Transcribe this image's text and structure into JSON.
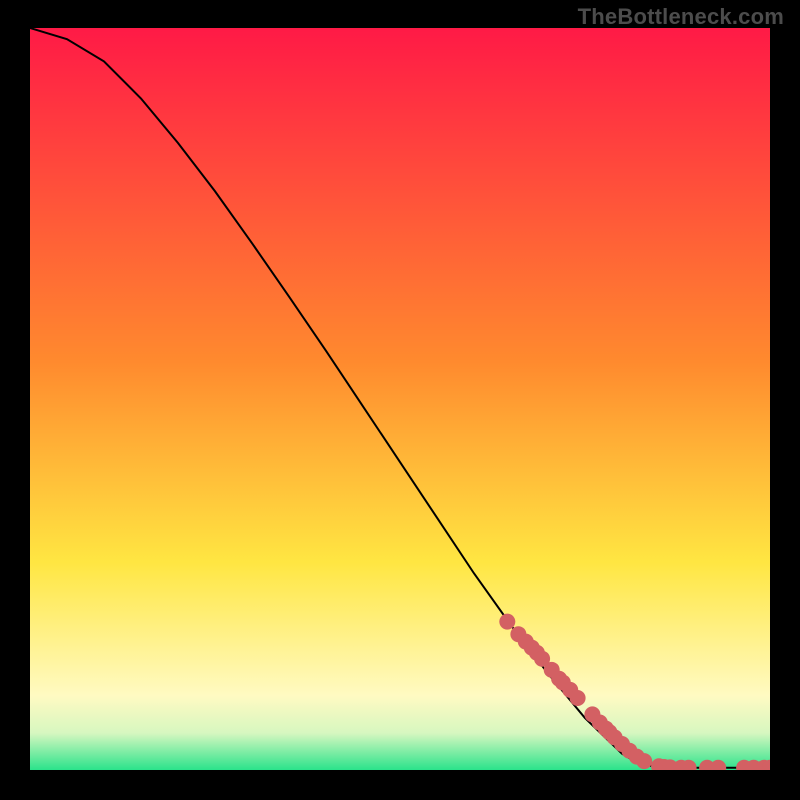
{
  "watermark": "TheBottleneck.com",
  "colors": {
    "bg": "#000000",
    "curve": "#000000",
    "marker": "#d36063",
    "watermark": "#4c4c4c",
    "grad_top": "#ff1a46",
    "grad_mid1": "#ff8a2e",
    "grad_mid2": "#ffe642",
    "grad_mid3": "#fffac2",
    "grad_band": "#d7f7c0",
    "grad_bot": "#2be38b"
  },
  "chart_data": {
    "type": "line",
    "title": "",
    "xlabel": "",
    "ylabel": "",
    "xlim": [
      0,
      100
    ],
    "ylim": [
      0,
      100
    ],
    "series": [
      {
        "name": "curve",
        "x": [
          0,
          5,
          10,
          15,
          20,
          25,
          30,
          35,
          40,
          45,
          50,
          55,
          60,
          65,
          70,
          75,
          80,
          82,
          85,
          90,
          95,
          100
        ],
        "y": [
          100,
          98.5,
          95.5,
          90.5,
          84.5,
          78,
          71,
          63.8,
          56.5,
          49,
          41.5,
          34,
          26.5,
          19.5,
          13,
          7,
          2.2,
          1.0,
          0.3,
          0.3,
          0.3,
          0.3
        ]
      },
      {
        "name": "markers",
        "x": [
          64.5,
          66.0,
          67.0,
          67.8,
          68.5,
          69.2,
          70.5,
          71.5,
          72.0,
          73.0,
          74.0,
          76.0,
          77.0,
          77.8,
          78.3,
          79.0,
          80.0,
          81.0,
          82.0,
          83.0,
          85.0,
          85.7,
          86.5,
          88.0,
          89.0,
          91.5,
          93.0,
          96.5,
          97.8,
          99.2,
          100.0
        ],
        "y": [
          20.0,
          18.3,
          17.3,
          16.5,
          15.8,
          15.0,
          13.5,
          12.3,
          11.8,
          10.8,
          9.7,
          7.5,
          6.4,
          5.6,
          5.1,
          4.4,
          3.5,
          2.6,
          1.8,
          1.2,
          0.5,
          0.4,
          0.35,
          0.3,
          0.3,
          0.3,
          0.3,
          0.3,
          0.3,
          0.3,
          0.3
        ]
      }
    ]
  }
}
